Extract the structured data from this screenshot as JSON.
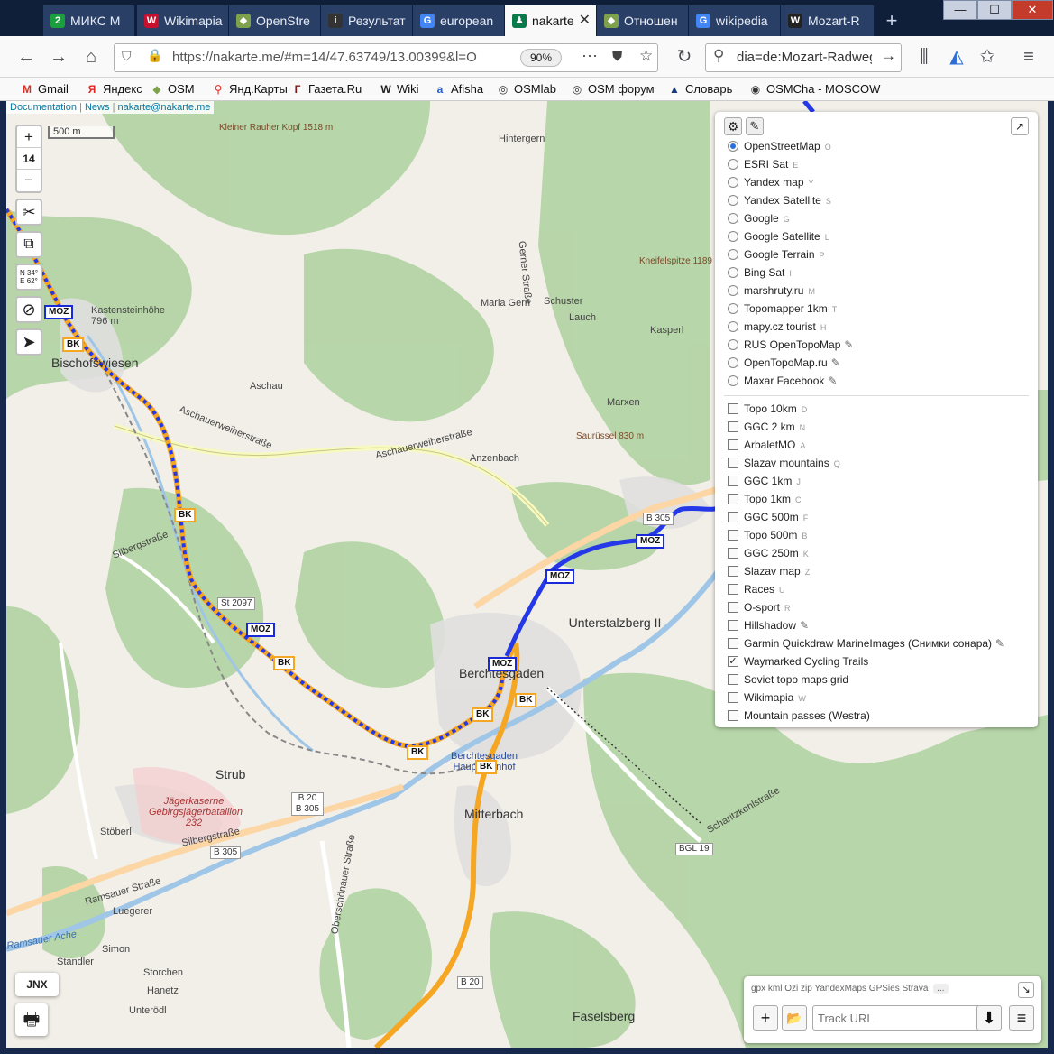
{
  "tabs": [
    {
      "label": "МИКС М",
      "icon": "2",
      "color": "#1b9e3e"
    },
    {
      "label": "Wikimapia",
      "icon": "W",
      "color": "#c8102e"
    },
    {
      "label": "OpenStre",
      "icon": "◆",
      "color": "#7ea24b"
    },
    {
      "label": "Результат",
      "icon": "i",
      "color": "#333333"
    },
    {
      "label": "european",
      "icon": "G",
      "color": "#4285f4"
    },
    {
      "label": "nakarte",
      "icon": "♟",
      "color": "#0a7a4a",
      "active": true
    },
    {
      "label": "Отношен",
      "icon": "◆",
      "color": "#7ea24b"
    },
    {
      "label": "wikipedia",
      "icon": "G",
      "color": "#4285f4"
    },
    {
      "label": "Mozart-R",
      "icon": "W",
      "color": "#222222"
    }
  ],
  "window_controls": {
    "minimize": "—",
    "maximize": "☐",
    "close": "✕"
  },
  "navbar": {
    "url": "https://nakarte.me/#m=14/47.63749/13.00399&l=O",
    "zoom": "90%",
    "search": "dia=de:Mozart-Radweg",
    "more": "···"
  },
  "bookmarks": [
    {
      "label": "Gmail",
      "icon": "M",
      "color": "#d93025"
    },
    {
      "label": "Яндекс",
      "icon": "Я",
      "color": "#e52620"
    },
    {
      "label": "OSM",
      "icon": "◆",
      "color": "#7ea24b"
    },
    {
      "label": "Янд.Карты",
      "icon": "⚲",
      "color": "#e52620"
    },
    {
      "label": "Газета.Ru",
      "icon": "Г",
      "color": "#7a1a1a"
    },
    {
      "label": "Wiki",
      "icon": "W",
      "color": "#222222"
    },
    {
      "label": "Afisha",
      "icon": "a",
      "color": "#1e5bd6"
    },
    {
      "label": "OSMlab",
      "icon": "◎",
      "color": "#333333"
    },
    {
      "label": "OSM форум",
      "icon": "◎",
      "color": "#333333"
    },
    {
      "label": "Словарь",
      "icon": "▲",
      "color": "#1a3a7a"
    },
    {
      "label": "OSMCha - MOSCOW",
      "icon": "◉",
      "color": "#333333"
    }
  ],
  "attribution": {
    "documentation": "Documentation",
    "sep": "|",
    "news": "News",
    "email": "nakarte@nakarte.me"
  },
  "map_controls": {
    "zoom_in": "+",
    "zoom_level": "14",
    "zoom_out": "−",
    "coords": "N 34° E 62°"
  },
  "scale": "500 m",
  "labels": {
    "towns": [
      "Bischofswiesen",
      "Berchtesgaden",
      "Strub",
      "Mitterbach",
      "Faselsberg",
      "Unterstalzberg II"
    ],
    "places": [
      "Hintergern",
      "Kastensteinhöhe 796 m",
      "Aschau",
      "Maria Gern",
      "Schuster",
      "Lauch",
      "Kasperl",
      "Marxen",
      "Anzenbach",
      "Stöberl",
      "Luegerer",
      "Simon",
      "Standler",
      "Storchen",
      "Hanetz",
      "Unterödl",
      "Jägerkaserne Gebirgsjägerbataillon 232",
      "Berchtesgaden Hauptbahnhof"
    ],
    "peaks": [
      "Kleiner Rauher Kopf 1518 m",
      "Kneifelspitze 1189 m",
      "Saurüssel 830 m"
    ],
    "streets": [
      "Aschauerweiherstraße",
      "Aschauerweiherstraße",
      "Silbergstraße",
      "Silbergstraße",
      "Ramsauer Straße",
      "Ramsauer Ache",
      "Oberschönauer Straße",
      "Scharitzkehlstraße",
      "Gerner Straße"
    ],
    "roads": [
      "B 305",
      "B 20 B 305",
      "B 305",
      "BGL 19",
      "B 20",
      "St 2097"
    ]
  },
  "route_shields": {
    "moz": "MOZ",
    "bk": "BK"
  },
  "layers": {
    "base": [
      {
        "name": "OpenStreetMap",
        "key": "O",
        "selected": true
      },
      {
        "name": "ESRI Sat",
        "key": "E"
      },
      {
        "name": "Yandex map",
        "key": "Y"
      },
      {
        "name": "Yandex Satellite",
        "key": "S"
      },
      {
        "name": "Google",
        "key": "G"
      },
      {
        "name": "Google Satellite",
        "key": "L"
      },
      {
        "name": "Google Terrain",
        "key": "P"
      },
      {
        "name": "Bing Sat",
        "key": "I"
      },
      {
        "name": "marshruty.ru",
        "key": "M"
      },
      {
        "name": "Topomapper 1km",
        "key": "T"
      },
      {
        "name": "mapy.cz tourist",
        "key": "H"
      },
      {
        "name": "RUS OpenTopoMap",
        "key": "",
        "pen": true
      },
      {
        "name": "OpenTopoMap.ru",
        "key": "",
        "pen": true
      },
      {
        "name": "Maxar Facebook",
        "key": "",
        "pen": true
      }
    ],
    "overlays": [
      {
        "name": "Topo 10km",
        "key": "D"
      },
      {
        "name": "GGC 2 km",
        "key": "N"
      },
      {
        "name": "ArbaletMO",
        "key": "A"
      },
      {
        "name": "Slazav mountains",
        "key": "Q"
      },
      {
        "name": "GGC 1km",
        "key": "J"
      },
      {
        "name": "Topo 1km",
        "key": "C"
      },
      {
        "name": "GGC 500m",
        "key": "F"
      },
      {
        "name": "Topo 500m",
        "key": "B"
      },
      {
        "name": "GGC 250m",
        "key": "K"
      },
      {
        "name": "Slazav map",
        "key": "Z"
      },
      {
        "name": "Races",
        "key": "U"
      },
      {
        "name": "O-sport",
        "key": "R"
      },
      {
        "name": "Hillshadow",
        "key": "",
        "pen": true
      },
      {
        "name": "Garmin Quickdraw MarineImages (Снимки сонара)",
        "key": "",
        "pen": true
      },
      {
        "name": "Waymarked Cycling Trails",
        "key": "",
        "checked": true
      },
      {
        "name": "Soviet topo maps grid",
        "key": ""
      },
      {
        "name": "Wikimapia",
        "key": "W"
      },
      {
        "name": "Mountain passes (Westra)",
        "key": ""
      }
    ]
  },
  "track_panel": {
    "formats": "gpx kml Ozi zip YandexMaps GPSies Strava",
    "more": "...",
    "url_placeholder": "Track URL",
    "add": "+",
    "open": "📂",
    "download": "⬇",
    "menu": "≡"
  },
  "jnx": "JNX",
  "print_icon": "🖶"
}
